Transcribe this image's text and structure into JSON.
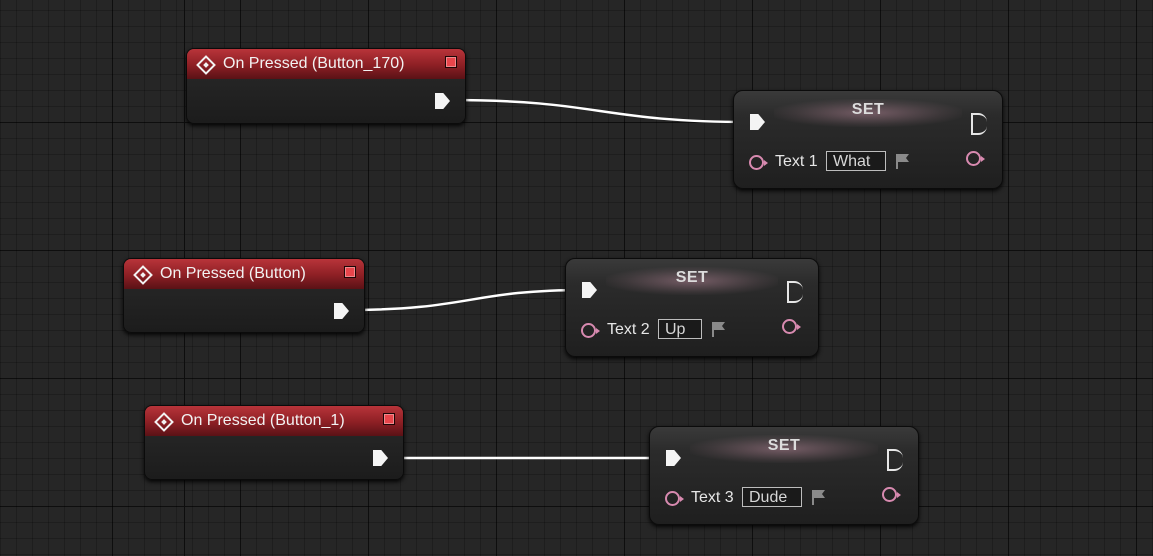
{
  "graph": {
    "event_nodes": [
      {
        "title": "On Pressed (Button_170)"
      },
      {
        "title": "On Pressed (Button)"
      },
      {
        "title": "On Pressed (Button_1)"
      }
    ],
    "set_nodes": [
      {
        "title": "SET",
        "variable": "Text 1",
        "value": "What"
      },
      {
        "title": "SET",
        "variable": "Text 2",
        "value": "Up"
      },
      {
        "title": "SET",
        "variable": "Text 3",
        "value": "Dude"
      }
    ]
  },
  "colors": {
    "background": "#262626",
    "event_header": "#a0282e",
    "exec_wire": "#ffffff",
    "text_pin": "#d88ab0",
    "delegate_pin": "#e8454b"
  },
  "icons": [
    "event-diamond-icon",
    "exec-pin-icon",
    "text-variable-pin-icon",
    "delegate-pin-icon",
    "localization-flag-icon"
  ]
}
